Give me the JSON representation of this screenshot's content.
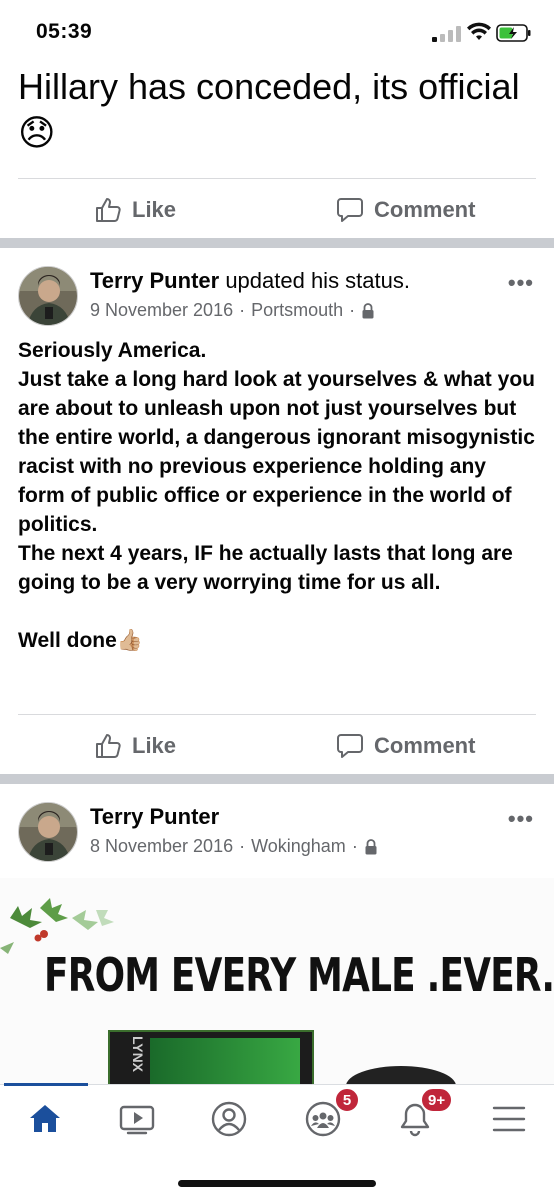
{
  "status_bar": {
    "time": "05:39"
  },
  "post0": {
    "text": "Hillary has conceded, its official 😞",
    "like_label": "Like",
    "comment_label": "Comment"
  },
  "post1": {
    "author": "Terry Punter",
    "action": "updated his status.",
    "date": "9 November 2016",
    "location": "Portsmouth",
    "separator": "·",
    "privacy_icon": "lock-icon",
    "body": "Seriously America.\nJust take a long hard look at yourselves & what you are about to unleash upon not just yourselves but the entire world, a dangerous ignorant misogynistic racist with no previous experience holding any form of public office or experience in the world of politics.\nThe next 4 years, IF he actually lasts that long are going to be a very worrying time for us all.\n\nWell done👍🏼",
    "like_label": "Like",
    "comment_label": "Comment"
  },
  "post2": {
    "author": "Terry Punter",
    "date": "8 November 2016",
    "location": "Wokingham",
    "separator": "·",
    "privacy_icon": "lock-icon",
    "image_headline": "FROM EVERY MALE .EVER.",
    "product_brand": "LYNX"
  },
  "more_glyph": "•••",
  "tab_bar": {
    "items": [
      {
        "name": "home",
        "icon": "home-icon",
        "active": true
      },
      {
        "name": "watch",
        "icon": "video-icon"
      },
      {
        "name": "profile",
        "icon": "profile-icon"
      },
      {
        "name": "groups",
        "icon": "groups-icon",
        "badge": "5"
      },
      {
        "name": "notifications",
        "icon": "bell-icon",
        "badge": "9+"
      },
      {
        "name": "menu",
        "icon": "menu-icon"
      }
    ]
  },
  "colors": {
    "facebook_blue": "#1b4f9c",
    "badge_red": "#c0263a",
    "secondary_text": "#65676b",
    "separator_gray": "#c9ccd1"
  }
}
